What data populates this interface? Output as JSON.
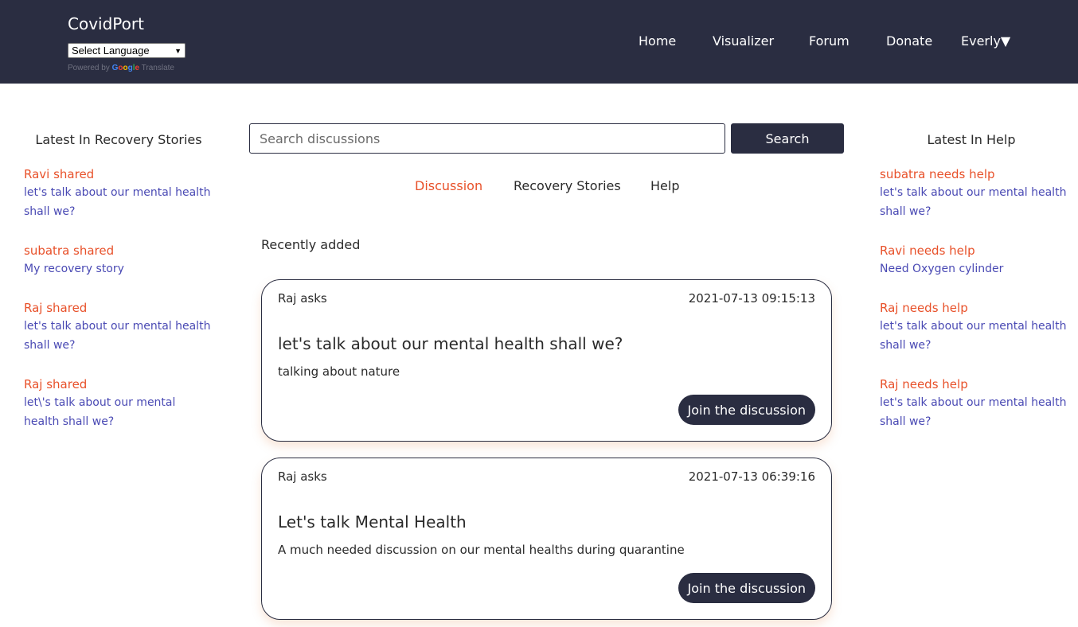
{
  "header": {
    "brand": "CovidPort",
    "language_select": "Select Language",
    "powered_prefix": "Powered by",
    "powered_google": "Google",
    "powered_suffix": "Translate",
    "nav": [
      "Home",
      "Visualizer",
      "Forum",
      "Donate",
      "Everly▼"
    ]
  },
  "left": {
    "title": "Latest In Recovery Stories",
    "items": [
      {
        "who": "Ravi shared",
        "link": "let's talk about our mental health shall we?"
      },
      {
        "who": "subatra shared",
        "link": "My recovery story"
      },
      {
        "who": "Raj shared",
        "link": "let's talk about our mental health shall we?"
      },
      {
        "who": "Raj shared",
        "link": "let\\'s talk about our mental health shall we?"
      }
    ]
  },
  "right": {
    "title": "Latest In Help",
    "items": [
      {
        "who": "subatra needs help",
        "link": "let's talk about our mental health shall we?"
      },
      {
        "who": "Ravi needs help",
        "link": "Need Oxygen cylinder"
      },
      {
        "who": "Raj needs help",
        "link": "let's talk about our mental health shall we?"
      },
      {
        "who": "Raj needs help",
        "link": "let's talk about our mental health shall we?"
      }
    ]
  },
  "search": {
    "placeholder": "Search discussions",
    "button": "Search"
  },
  "tabs": [
    "Discussion",
    "Recovery Stories",
    "Help"
  ],
  "active_tab": "Discussion",
  "recent_label": "Recently added",
  "cards": [
    {
      "who": "Raj asks",
      "date": "2021-07-13 09:15:13",
      "title": "let's talk about our mental health shall we?",
      "body": "talking about nature",
      "button": "Join the discussion"
    },
    {
      "who": "Raj asks",
      "date": "2021-07-13 06:39:16",
      "title": "Let's talk Mental Health",
      "body": "A much needed discussion on our mental healths during quarantine",
      "button": "Join the discussion"
    }
  ],
  "colors": {
    "header_bg": "#2a2d41",
    "accent": "#e8512a",
    "link": "#4a4ab4"
  }
}
